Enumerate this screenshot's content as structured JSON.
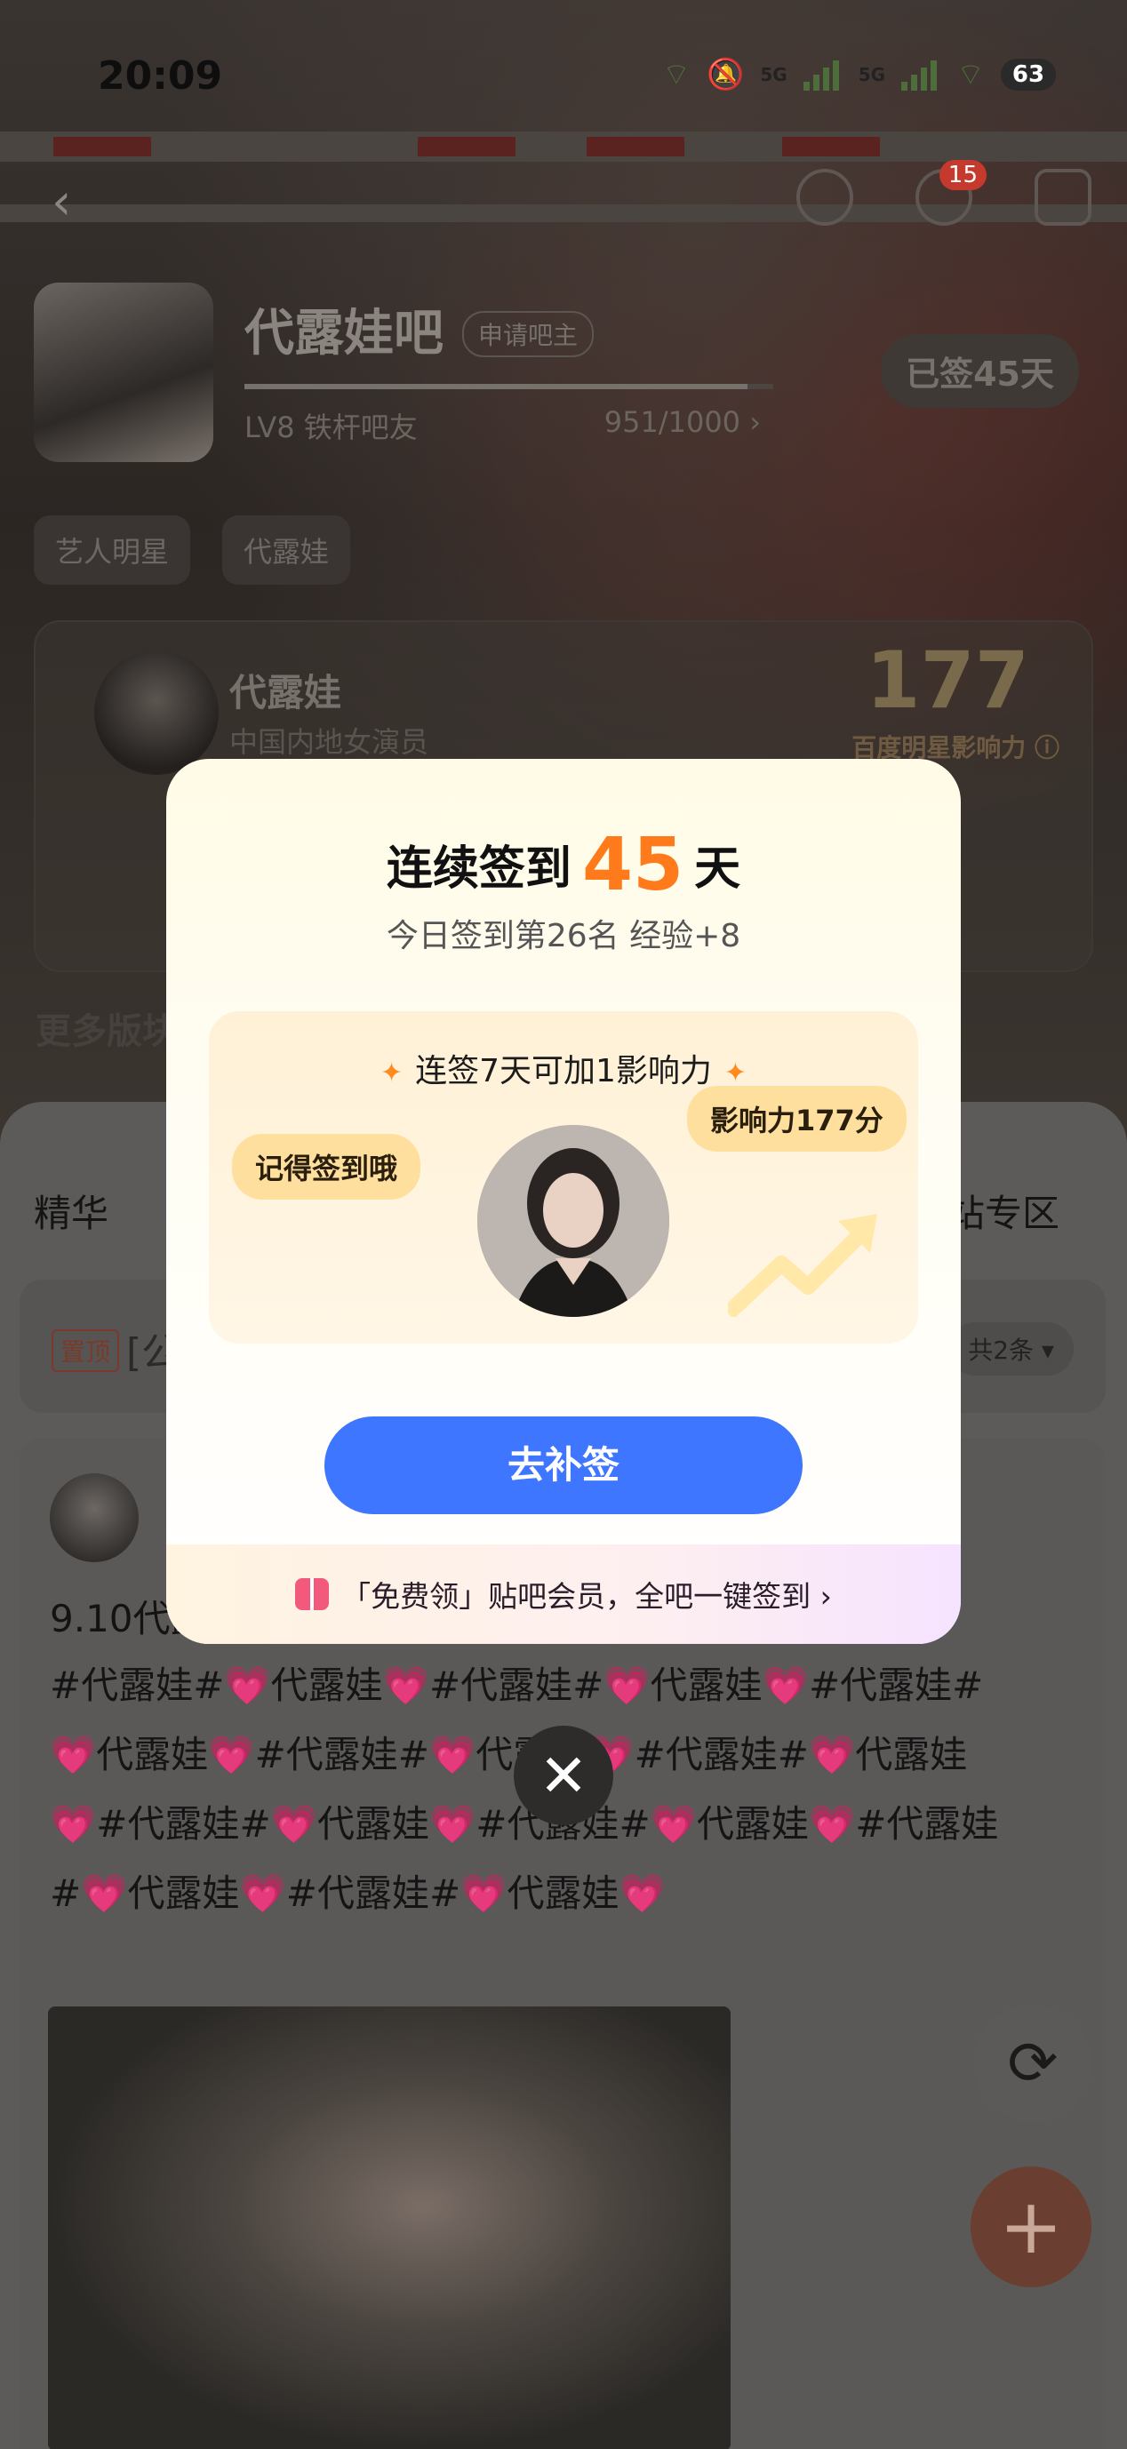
{
  "status_bar": {
    "time": "20:09",
    "net_1": "5G",
    "net_2": "5G",
    "battery": "63"
  },
  "header": {
    "message_badge": "15"
  },
  "forum": {
    "title": "代露娃吧",
    "apply_label": "申请吧主",
    "level": "LV8 铁杆吧友",
    "exp": "951/1000 ›",
    "exp_progress": 0.951,
    "signed_label": "已签45天",
    "tags": [
      "艺人明星",
      "代露娃"
    ]
  },
  "star_card": {
    "name": "代露娃",
    "desc": "中国内地女演员",
    "influence": "177",
    "influence_label": "百度明星影响力 ⓘ"
  },
  "more_label": "更多版块",
  "feed": {
    "tabs": [
      "精华",
      "站专区"
    ],
    "pinned_badge": "置顶",
    "pinned_text": "[公",
    "pinned_count": "共2条 ▾",
    "post_title": "9.10代露",
    "post_lines": [
      "#代露娃#💗代露娃💗#代露娃#💗代露娃💗#代露娃#",
      "💗代露娃💗#代露娃#💗代露娃💗#代露娃#💗代露娃",
      "💗#代露娃#💗代露娃💗#代露娃#💗代露娃💗#代露娃",
      "#💗代露娃💗#代露娃#💗代露娃💗"
    ]
  },
  "modal": {
    "title_prefix": "连续签到",
    "days": "45",
    "title_suffix": "天",
    "subtitle": "今日签到第26名 经验+8",
    "reward_head": "连签7天可加1影响力",
    "bubble_left": "记得签到哦",
    "bubble_right": "影响力177分",
    "cta": "去补签",
    "vip_text": "「免费领」贴吧会员，全吧一键签到 ›"
  },
  "icons": {
    "back": "chevron-left-icon",
    "search": "search-icon",
    "message": "message-icon",
    "edit": "edit-icon",
    "refresh": "refresh-icon",
    "add": "plus-icon",
    "close": "close-icon",
    "gift": "gift-icon"
  },
  "colors": {
    "accent_orange": "#ff7a1a",
    "cta_blue": "#3f76ff",
    "badge_red": "#c53a2c"
  }
}
